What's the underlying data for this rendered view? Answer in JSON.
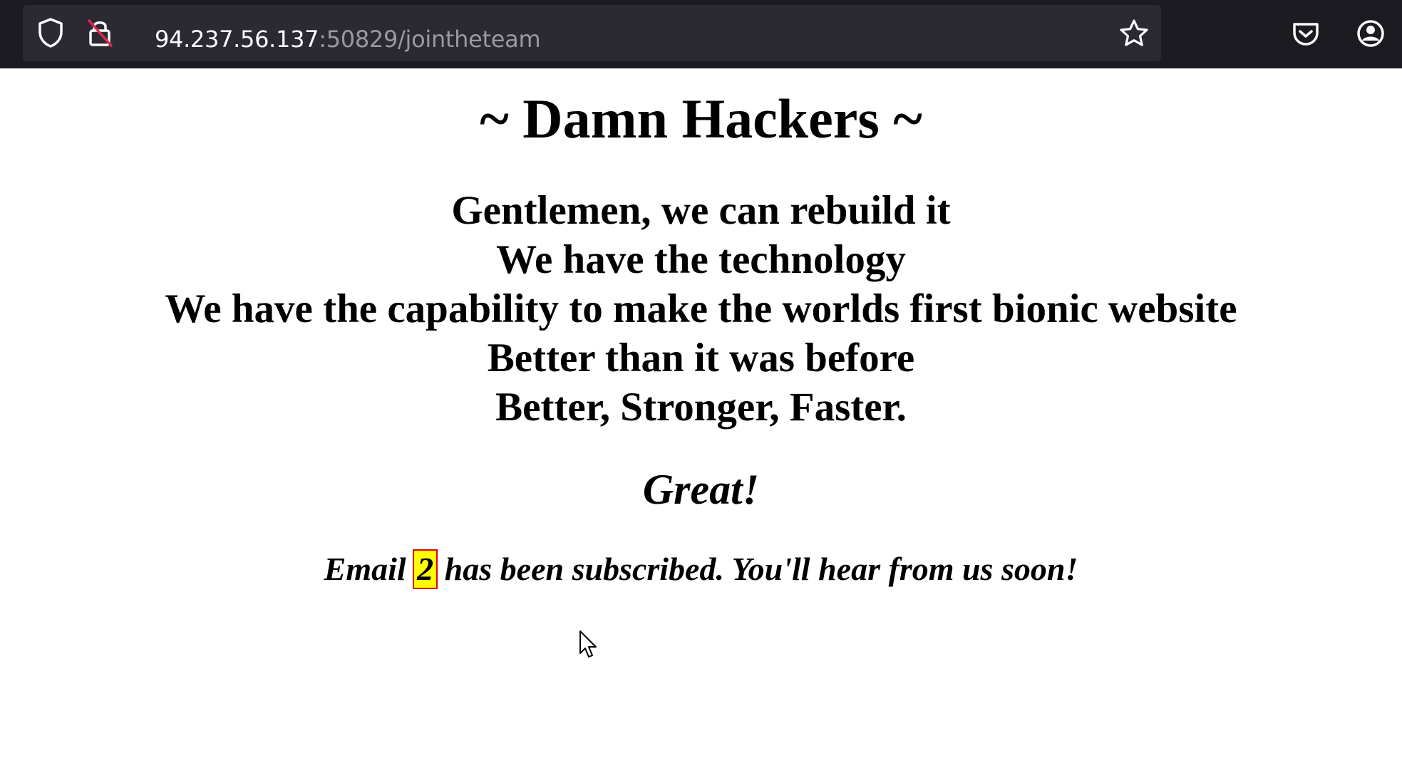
{
  "browser": {
    "url_host": "94.237.56.137",
    "url_rest": ":50829/jointheteam",
    "icons": {
      "tracking_protection": "shield-icon",
      "connection": "insecure-lock-icon",
      "bookmark": "star-icon",
      "pocket": "pocket-icon",
      "account": "account-icon"
    }
  },
  "page": {
    "title": "~ Damn Hackers ~",
    "lyrics": [
      "Gentlemen, we can rebuild it",
      "We have the technology",
      "We have the capability to make the worlds first bionic website",
      "Better than it was before",
      "Better, Stronger, Faster."
    ],
    "great": "Great!",
    "message_prefix": "Email",
    "email_value": "2",
    "message_suffix": "has been subscribed. You'll hear from us soon!",
    "highlight_colors": {
      "background": "#ffff00",
      "border": "#e00000"
    }
  }
}
